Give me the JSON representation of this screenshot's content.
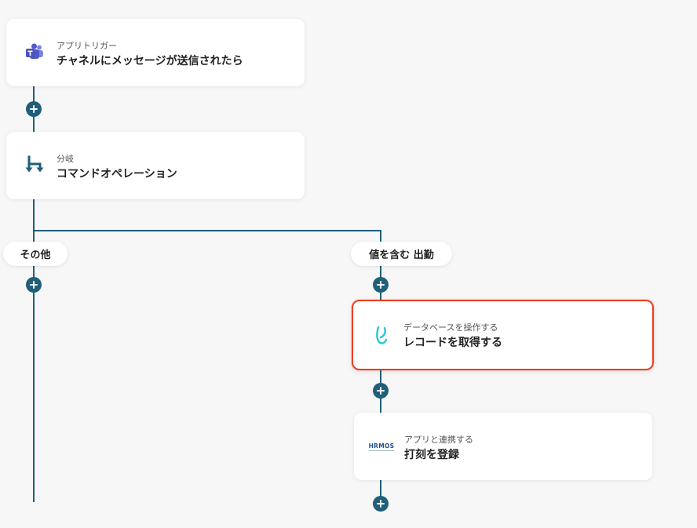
{
  "flow": {
    "steps": [
      {
        "subtitle": "アプリトリガー",
        "title": "チャネルにメッセージが送信されたら",
        "icon": "teams-icon"
      },
      {
        "subtitle": "分岐",
        "title": "コマンドオペレーション",
        "icon": "branch-icon"
      },
      {
        "subtitle": "データベースを操作する",
        "title": "レコードを取得する",
        "icon": "yoom-database-icon"
      },
      {
        "subtitle": "アプリと連携する",
        "title": "打刻を登録",
        "icon": "hrmos-icon"
      }
    ],
    "branches": {
      "left_label": "その他",
      "right_label": "値を含む 出勤"
    },
    "hrmos_logo_text": "HRMOS",
    "colors": {
      "connector": "#1f5f7a",
      "selected_border": "#ef3f22",
      "background": "#f7f7f7"
    }
  }
}
